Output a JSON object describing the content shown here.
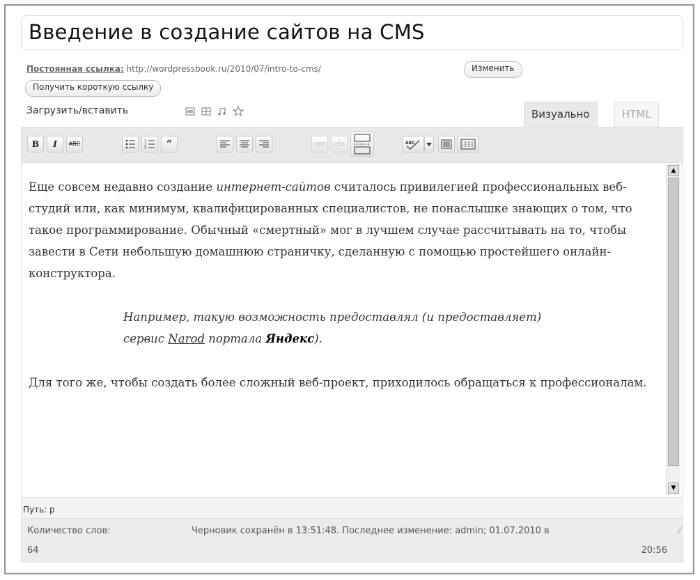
{
  "title": "Введение в создание сайтов на CMS",
  "permalink": {
    "label": "Постоянная ссылка:",
    "url": "http://wordpressbook.ru/2010/07/intro-to-cms/",
    "edit_button": "Изменить",
    "shortlink_button": "Получить короткую ссылку"
  },
  "media": {
    "label": "Загрузить/вставить",
    "icons": [
      "image-icon",
      "video-icon",
      "audio-icon",
      "media-icon"
    ]
  },
  "tabs": {
    "visual": "Визуально",
    "html": "HTML"
  },
  "toolbar": {
    "bold": "B",
    "italic": "I",
    "strike": "ABC"
  },
  "content": {
    "p1_a": "Еще совсем недавно создание ",
    "p1_em": "интернет-сайтов",
    "p1_b": " считалось привилегией профессиональных веб-студий или, как минимум, квалифицированных специалистов, не понаслышке знающих о том, что такое программирование. Обычный «смертный» мог в лучшем случае рассчитывать на то, чтобы завести в Сети небольшую домашнюю страничку, сделанную с помощью простейшего онлайн-конструктора.",
    "bq_a": "Например, такую возможность предоставлял (и предоставляет) сервис ",
    "bq_link": "Narod",
    "bq_b": " портала ",
    "bq_bold": "Яндекс",
    "bq_c": ").",
    "p2": "Для того же, чтобы создать более сложный веб-проект, приходилось обращаться к профессионалам."
  },
  "path": "Путь: p",
  "status": {
    "word_count_label": "Количество слов:",
    "word_count": "64",
    "draft_line1": "Черновик сохранён в 13:51:48. Последнее изменение: admin; 01.07.2010 в",
    "draft_line2": "20:56"
  }
}
